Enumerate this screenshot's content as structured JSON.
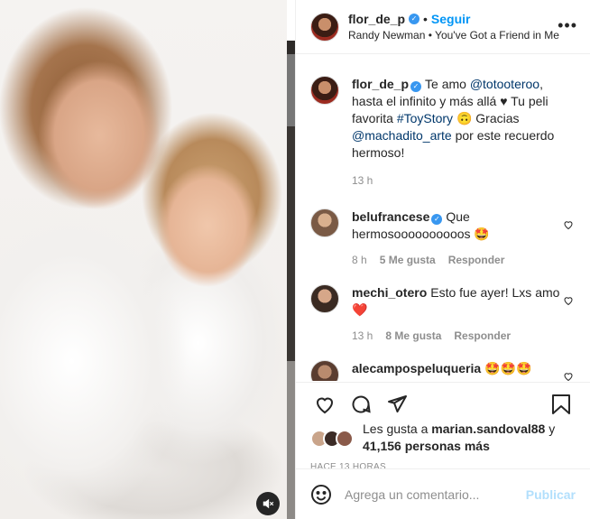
{
  "post": {
    "username": "flor_de_p",
    "follow_label": "Seguir",
    "separator": "•",
    "audio_artist": "Randy Newman",
    "audio_title": "You've Got a Friend in Me",
    "audio_sep": "•"
  },
  "caption": {
    "username": "flor_de_p",
    "t1": "Te amo ",
    "mention1": "@totooteroo",
    "t2": ", hasta el infinito y más allá ♥ Tu peli favorita ",
    "hashtag": "#ToyStory",
    "emoji": "🙃",
    "t3": " Gracias ",
    "mention2": "@machadito_arte",
    "t4": " por este recuerdo hermoso!",
    "time": "13 h"
  },
  "comments": [
    {
      "username": "belufrancese",
      "text": "Que hermosoooooooooos 🤩",
      "time": "8 h",
      "likes": "5 Me gusta",
      "reply": "Responder"
    },
    {
      "username": "mechi_otero",
      "text": "Esto fue ayer! Lxs amo ❤️",
      "time": "13 h",
      "likes": "8 Me gusta",
      "reply": "Responder"
    },
    {
      "username": "alecampospeluqueria",
      "text": "🤩🤩🤩"
    }
  ],
  "likes": {
    "prefix": "Les gusta a ",
    "user": "marian.sandoval88",
    "mid": " y",
    "count": "41,156 personas más"
  },
  "timestamp": "HACE 13 HORAS",
  "add_comment": {
    "placeholder": "Agrega un comentario...",
    "publish": "Publicar"
  },
  "colors": {
    "accent": "#0095f6",
    "verified": "#3897f0",
    "heart": "#ed4956"
  },
  "icons": [
    "more-icon",
    "verified-icon",
    "heart-icon",
    "comment-icon",
    "share-icon",
    "save-icon",
    "emoji-icon",
    "mute-icon"
  ]
}
